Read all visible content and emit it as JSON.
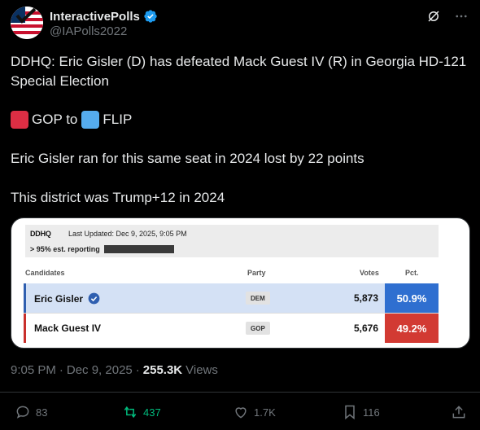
{
  "user": {
    "display_name": "InteractivePolls",
    "handle": "@IAPolls2022"
  },
  "tweet": {
    "line1": "DDHQ: Eric Gisler (D) has defeated Mack Guest IV (R) in Georgia HD-121 Special Election",
    "flip_from": "GOP to",
    "flip_to": "FLIP",
    "line3": "Eric Gisler ran for this same seat in 2024 lost by 22 points",
    "line4": "This district was Trump+12 in 2024"
  },
  "card": {
    "source": "DDHQ",
    "updated": "Last Updated: Dec 9, 2025, 9:05 PM",
    "reporting": "> 95% est. reporting",
    "headers": {
      "candidates": "Candidates",
      "party": "Party",
      "votes": "Votes",
      "pct": "Pct."
    },
    "rows": [
      {
        "name": "Eric Gisler",
        "party": "DEM",
        "votes": "5,873",
        "pct": "50.9%",
        "color": "#2f6fd0"
      },
      {
        "name": "Mack Guest IV",
        "party": "GOP",
        "votes": "5,676",
        "pct": "49.2%",
        "color": "#d23a33"
      }
    ]
  },
  "meta": {
    "time": "9:05 PM",
    "date": "Dec 9, 2025",
    "views_count": "255.3K",
    "views_label": "Views"
  },
  "actions": {
    "replies": "83",
    "reposts": "437",
    "likes": "1.7K",
    "bookmarks": "116"
  },
  "colors": {
    "gop_square": "#dd2e44",
    "flip_square": "#55acee",
    "repost_active": "#00ba7c",
    "verified": "#1d9bf0"
  }
}
